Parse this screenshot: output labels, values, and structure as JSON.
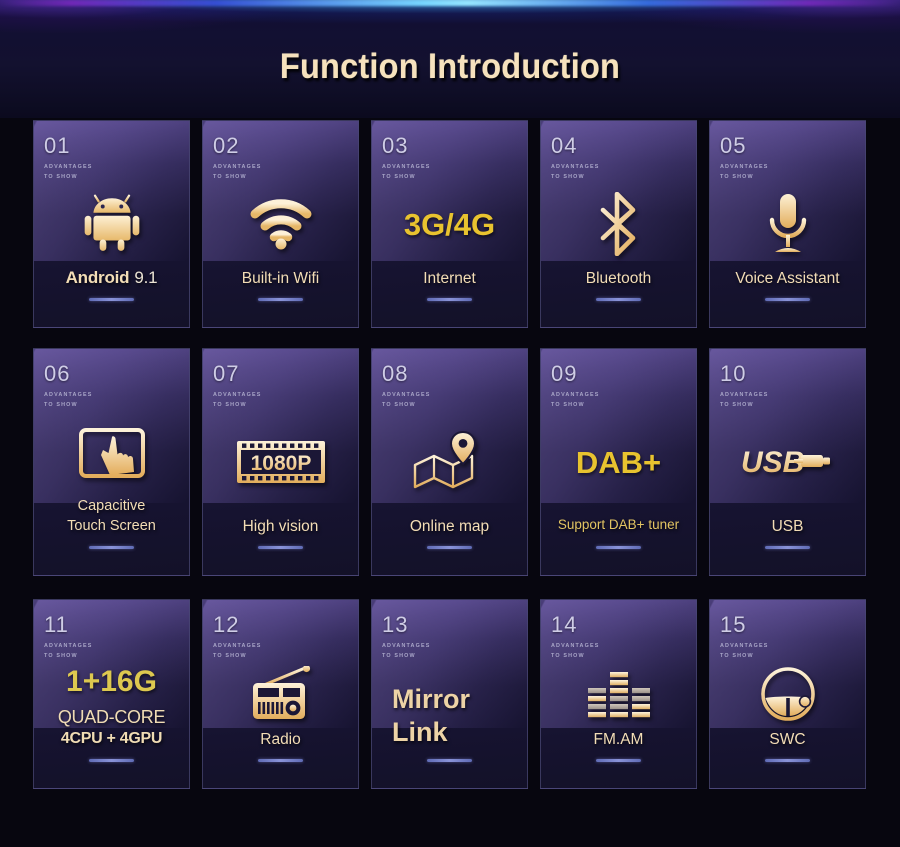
{
  "header": {
    "title": "Function Introduction"
  },
  "card_common": {
    "advantages_line1": "ADVANTAGES",
    "advantages_line2": "TO SHOW"
  },
  "colors": {
    "gold": "#e8c32f",
    "cream": "#f3ddb6",
    "underline": "#8a93d8",
    "card_bg": "#1c1838",
    "page_bg": "#07060f",
    "title": "#f6e2bd"
  },
  "cards": [
    {
      "number": "01",
      "icon": "android-robot-icon",
      "title": "Android",
      "title_extra": "9.1"
    },
    {
      "number": "02",
      "icon": "wifi-icon",
      "title": "Built-in Wifi"
    },
    {
      "number": "03",
      "icon": "text-3g4g",
      "big_text": "3G/4G",
      "title": "Internet"
    },
    {
      "number": "04",
      "icon": "bluetooth-icon",
      "title": "Bluetooth"
    },
    {
      "number": "05",
      "icon": "microphone-icon",
      "title": "Voice Assistant"
    },
    {
      "number": "06",
      "icon": "touch-screen-icon",
      "title_line1": "Capacitive",
      "title_line2": "Touch Screen"
    },
    {
      "number": "07",
      "icon": "film-strip-1080p-icon",
      "icon_label": "1080P",
      "title": "High vision"
    },
    {
      "number": "08",
      "icon": "map-pin-icon",
      "title": "Online map"
    },
    {
      "number": "09",
      "icon": "text-dabplus",
      "big_text": "DAB+",
      "title": "Support DAB+ tuner"
    },
    {
      "number": "10",
      "icon": "usb-logo-icon",
      "icon_label": "USB",
      "title": "USB"
    },
    {
      "number": "11",
      "icon": "text-memory",
      "big_text": "1+16G",
      "title_line1": "QUAD-CORE",
      "title_line2": "4CPU + 4GPU"
    },
    {
      "number": "12",
      "icon": "radio-icon",
      "title": "Radio"
    },
    {
      "number": "13",
      "icon": "text-mirror-link",
      "title_line1": "Mirror",
      "title_line2": "Link"
    },
    {
      "number": "14",
      "icon": "equalizer-icon",
      "title": "FM.AM"
    },
    {
      "number": "15",
      "icon": "steering-wheel-icon",
      "title": "SWC"
    }
  ]
}
